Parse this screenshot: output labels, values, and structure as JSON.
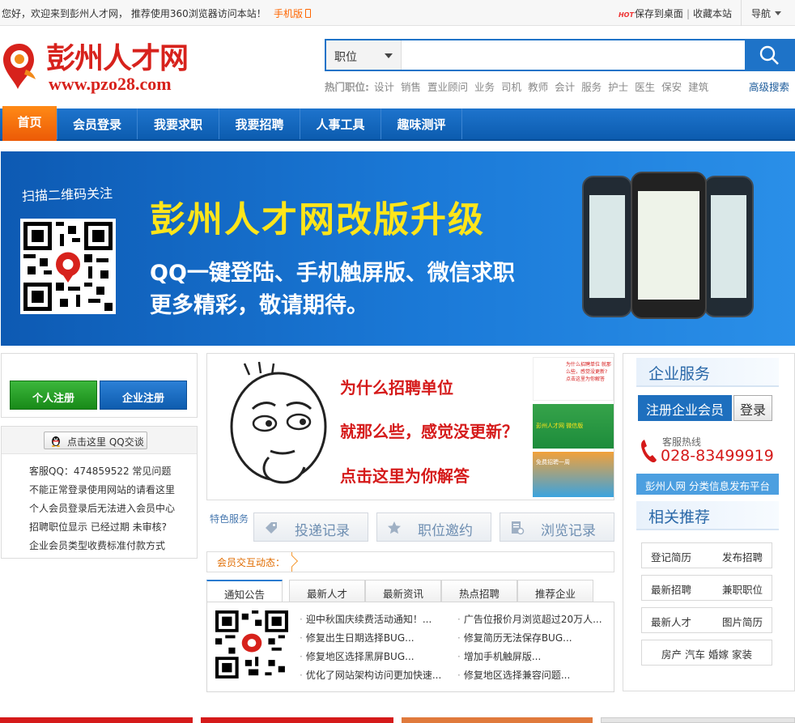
{
  "topbar": {
    "welcome": "您好，欢迎来到彭州人才网，  推荐使用360浏览器访问本站！",
    "mobile_label": "手机版",
    "hot_badge": "HOT",
    "save_desktop": "保存到桌面",
    "favorite": "收藏本站",
    "nav_label": "导航"
  },
  "logo": {
    "title": "彭州人才网",
    "url": "www.pzo28.com"
  },
  "search": {
    "category": "职位",
    "placeholder": "",
    "hot_label": "热门职位:",
    "hot_jobs": [
      "设计",
      "销售",
      "置业顾问",
      "业务",
      "司机",
      "教师",
      "会计",
      "服务",
      "护士",
      "医生",
      "保安",
      "建筑"
    ],
    "advanced": "高级搜索"
  },
  "nav": {
    "home": "首页",
    "items": [
      "会员登录",
      "我要求职",
      "我要招聘",
      "人事工具",
      "趣味测评"
    ]
  },
  "banner": {
    "scan_text": "扫描二维码关注",
    "title": "彭州人才网改版升级",
    "line1": "QQ一键登陆、手机触屏版、微信求职",
    "line2": "更多精彩，敬请期待。"
  },
  "left": {
    "personal_register": "个人注册",
    "company_register": "企业注册",
    "qq_button": "点击这里 QQ交谈",
    "faq": [
      "客服QQ：474859522 常见问题",
      "不能正常登录使用网站的请看这里",
      "个人会员登录后无法进入会员中心",
      "招聘职位显示  已经过期  未审核?",
      "企业会员类型收费标准付款方式"
    ]
  },
  "promo": {
    "line1": "为什么招聘单位",
    "line2": "就那么些，感觉没更新？",
    "line3": "点击这里为你解答",
    "thumb1_text": "为什么招聘单位 就那么些，感觉没更新? 点击这里为你解答",
    "thumb2_text": "彭州人才网 微信版",
    "thumb3_text": "免费招聘一周"
  },
  "features": {
    "label": "特色服务",
    "items": [
      "投递记录",
      "职位邀约",
      "浏览记录"
    ]
  },
  "interact": {
    "label": "会员交互动态："
  },
  "tabs": {
    "items": [
      "通知公告",
      "最新人才",
      "最新资讯",
      "热点招聘",
      "推荐企业"
    ],
    "active": 0
  },
  "news": {
    "left": [
      "迎中秋国庆续费活动通知！...",
      "修复出生日期选择BUG...",
      "修复地区选择黑屏BUG...",
      "优化了网站架构访问更加快速..."
    ],
    "right": [
      "广告位报价月浏览超过20万人...",
      "修复简历无法保存BUG...",
      "增加手机触屏版...",
      "修复地区选择兼容问题..."
    ]
  },
  "right": {
    "service_title": "企业服务",
    "register_corp": "注册企业会员",
    "login": "登录",
    "hotline_label": "客服热线",
    "hotline": "028-83499919",
    "platform": "彭州人网  分类信息发布平台",
    "related_title": "相关推荐",
    "links": [
      [
        "登记简历",
        "发布招聘"
      ],
      [
        "最新招聘",
        "兼职职位"
      ],
      [
        "最新人才",
        "图片简历"
      ]
    ],
    "last_row": "房产  汽车  婚嫁  家装"
  },
  "colors": {
    "brand_red": "#d7221c",
    "nav_blue": "#1e74cd",
    "home_orange": "#f06a0a",
    "banner_yellow": "#ffe51a"
  }
}
